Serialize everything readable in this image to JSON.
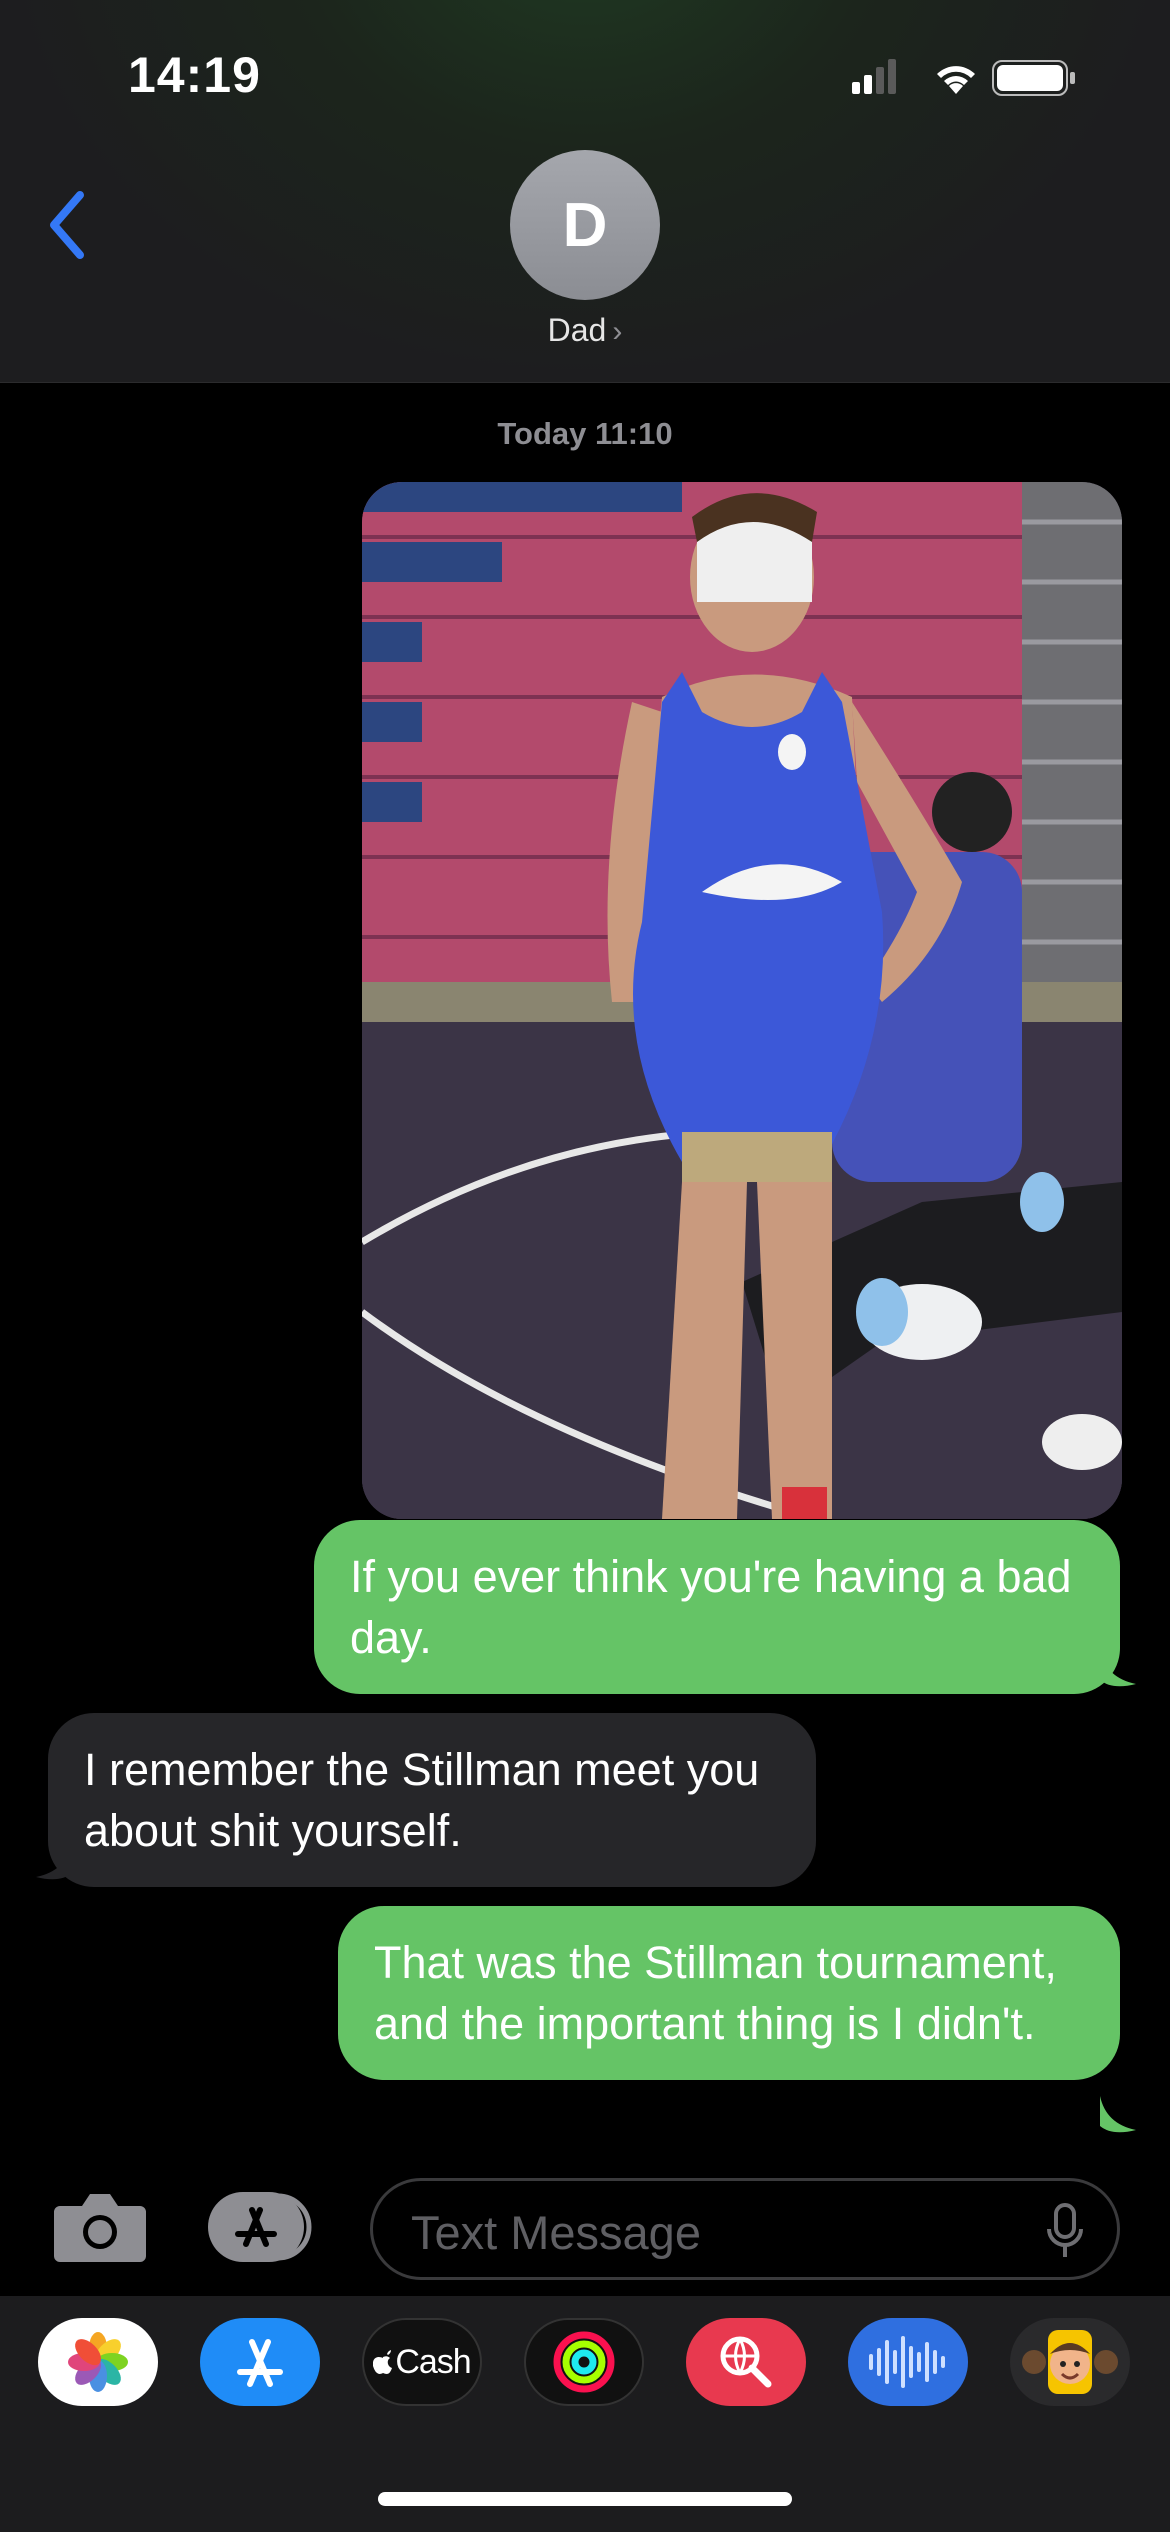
{
  "status_bar": {
    "time": "14:19"
  },
  "header": {
    "avatar_initial": "D",
    "contact_name": "Dad",
    "contact_chevron": "›"
  },
  "thread": {
    "timestamp": "Today 11:10",
    "messages": [
      {
        "from": "me",
        "type": "photo"
      },
      {
        "from": "me",
        "text": "If you ever think you're having a bad day."
      },
      {
        "from": "them",
        "text": "I remember the Stillman meet you about shit yourself."
      },
      {
        "from": "me",
        "text": "That was the Stillman tournament, and the important thing is I didn't."
      }
    ]
  },
  "composer": {
    "placeholder": "Text Message"
  },
  "app_tray": {
    "cash_label": "Cash"
  },
  "colors": {
    "sent": "#65c466",
    "received": "#262629",
    "accent": "#3478f6"
  }
}
